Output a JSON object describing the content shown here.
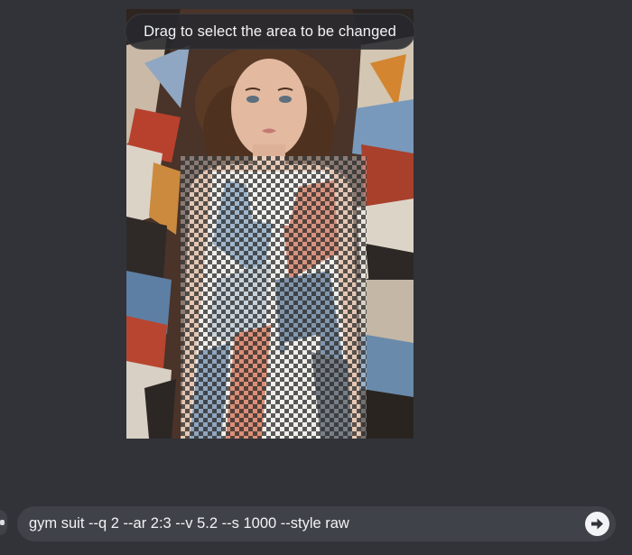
{
  "hint": {
    "text": "Drag to select the area to be changed"
  },
  "image": {
    "description_icon": "portrait-image"
  },
  "prompt": {
    "value": "gym suit --q 2 --ar 2:3 --v 5.2 --s 1000 --style raw",
    "submit_icon": "arrow-right-circle-icon"
  },
  "colors": {
    "background": "#313338",
    "prompt_bar": "#404249",
    "text": "#f2f3f5"
  }
}
